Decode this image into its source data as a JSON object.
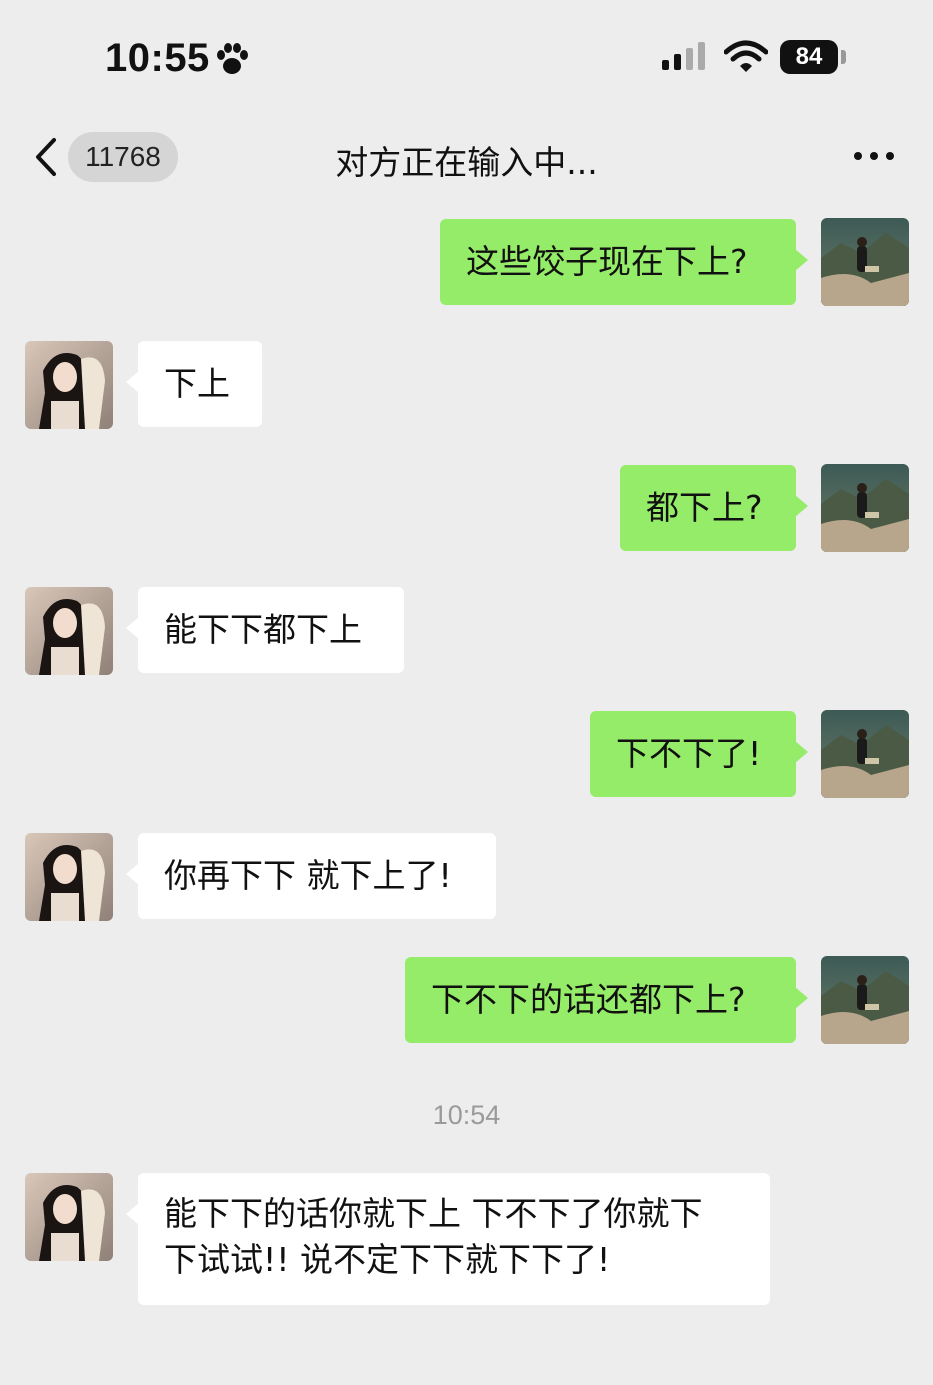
{
  "status_bar": {
    "time": "10:55",
    "battery": "84",
    "icons": [
      "paw-icon",
      "signal-icon",
      "wifi-icon",
      "battery-icon"
    ]
  },
  "nav": {
    "back_icon": "chevron-left-icon",
    "unread_count": "11768",
    "title": "对方正在输入中...",
    "more_icon": "more-dots-icon"
  },
  "colors": {
    "background": "#ededed",
    "outgoing_bubble": "#95ec69",
    "incoming_bubble": "#ffffff",
    "timestamp_text": "#9a9a9a"
  },
  "messages": [
    {
      "direction": "out",
      "text": "这些饺子现在下上?"
    },
    {
      "direction": "in",
      "text": "下上"
    },
    {
      "direction": "out",
      "text": "都下上?"
    },
    {
      "direction": "in",
      "text": "能下下都下上"
    },
    {
      "direction": "out",
      "text": "下不下了!"
    },
    {
      "direction": "in",
      "text": "你再下下 就下上了!"
    },
    {
      "direction": "out",
      "text": "下不下的话还都下上?"
    },
    {
      "direction": "in",
      "line1": "能下下的话你就下上 下不下了你就下",
      "line2": "下试试!! 说不定下下就下下了!"
    }
  ],
  "timestamp": "10:54"
}
